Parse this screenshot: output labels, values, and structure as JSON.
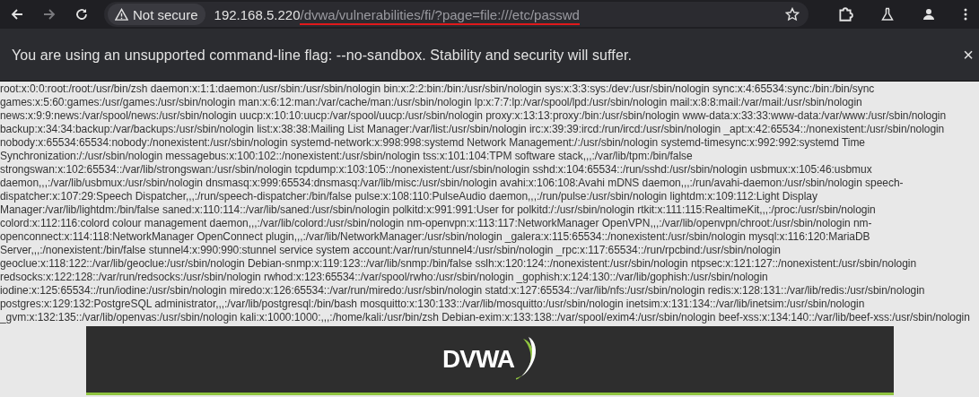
{
  "toolbar": {
    "security_label": "Not secure",
    "url_host": "192.168.5.220",
    "url_path": "/dvwa/vulnerabilities/fi/?page=file:///etc/passwd",
    "back_enabled": true,
    "forward_enabled": false
  },
  "infobar": {
    "message": "You are using an unsupported command-line flag: --no-sandbox. Stability and security will suffer.",
    "close": "×"
  },
  "page": {
    "file_lines": [
      "root:x:0:0:root:/root:/usr/bin/zsh daemon:x:1:1:daemon:/usr/sbin:/usr/sbin/nologin bin:x:2:2:bin:/bin:/usr/sbin/nologin sys:x:3:3:sys:/dev:/usr/sbin/nologin sync:x:4:65534:sync:/bin:/bin/sync",
      "games:x:5:60:games:/usr/games:/usr/sbin/nologin man:x:6:12:man:/var/cache/man:/usr/sbin/nologin lp:x:7:7:lp:/var/spool/lpd:/usr/sbin/nologin mail:x:8:8:mail:/var/mail:/usr/sbin/nologin",
      "news:x:9:9:news:/var/spool/news:/usr/sbin/nologin uucp:x:10:10:uucp:/var/spool/uucp:/usr/sbin/nologin proxy:x:13:13:proxy:/bin:/usr/sbin/nologin www-data:x:33:33:www-data:/var/www:/usr/sbin/nologin",
      "backup:x:34:34:backup:/var/backups:/usr/sbin/nologin list:x:38:38:Mailing List Manager:/var/list:/usr/sbin/nologin irc:x:39:39:ircd:/run/ircd:/usr/sbin/nologin _apt:x:42:65534::/nonexistent:/usr/sbin/nologin",
      "nobody:x:65534:65534:nobody:/nonexistent:/usr/sbin/nologin systemd-network:x:998:998:systemd Network Management:/:/usr/sbin/nologin systemd-timesync:x:992:992:systemd Time",
      "Synchronization:/:/usr/sbin/nologin messagebus:x:100:102::/nonexistent:/usr/sbin/nologin tss:x:101:104:TPM software stack,,,:/var/lib/tpm:/bin/false",
      "strongswan:x:102:65534::/var/lib/strongswan:/usr/sbin/nologin tcpdump:x:103:105::/nonexistent:/usr/sbin/nologin sshd:x:104:65534::/run/sshd:/usr/sbin/nologin usbmux:x:105:46:usbmux",
      "daemon,,,:/var/lib/usbmux:/usr/sbin/nologin dnsmasq:x:999:65534:dnsmasq:/var/lib/misc:/usr/sbin/nologin avahi:x:106:108:Avahi mDNS daemon,,,:/run/avahi-daemon:/usr/sbin/nologin speech-",
      "dispatcher:x:107:29:Speech Dispatcher,,,:/run/speech-dispatcher:/bin/false pulse:x:108:110:PulseAudio daemon,,,:/run/pulse:/usr/sbin/nologin lightdm:x:109:112:Light Display",
      "Manager:/var/lib/lightdm:/bin/false saned:x:110:114::/var/lib/saned:/usr/sbin/nologin polkitd:x:991:991:User for polkitd:/:/usr/sbin/nologin rtkit:x:111:115:RealtimeKit,,,:/proc:/usr/sbin/nologin",
      "colord:x:112:116:colord colour management daemon,,,:/var/lib/colord:/usr/sbin/nologin nm-openvpn:x:113:117:NetworkManager OpenVPN,,,:/var/lib/openvpn/chroot:/usr/sbin/nologin nm-",
      "openconnect:x:114:118:NetworkManager OpenConnect plugin,,,:/var/lib/NetworkManager:/usr/sbin/nologin _galera:x:115:65534::/nonexistent:/usr/sbin/nologin mysql:x:116:120:MariaDB",
      "Server,,,:/nonexistent:/bin/false stunnel4:x:990:990:stunnel service system account:/var/run/stunnel4:/usr/sbin/nologin _rpc:x:117:65534::/run/rpcbind:/usr/sbin/nologin",
      "geoclue:x:118:122::/var/lib/geoclue:/usr/sbin/nologin Debian-snmp:x:119:123::/var/lib/snmp:/bin/false sslh:x:120:124::/nonexistent:/usr/sbin/nologin ntpsec:x:121:127::/nonexistent:/usr/sbin/nologin",
      "redsocks:x:122:128::/var/run/redsocks:/usr/sbin/nologin rwhod:x:123:65534::/var/spool/rwho:/usr/sbin/nologin _gophish:x:124:130::/var/lib/gophish:/usr/sbin/nologin",
      "iodine:x:125:65534::/run/iodine:/usr/sbin/nologin miredo:x:126:65534::/var/run/miredo:/usr/sbin/nologin statd:x:127:65534::/var/lib/nfs:/usr/sbin/nologin redis:x:128:131::/var/lib/redis:/usr/sbin/nologin",
      "postgres:x:129:132:PostgreSQL administrator,,,:/var/lib/postgresql:/bin/bash mosquitto:x:130:133::/var/lib/mosquitto:/usr/sbin/nologin inetsim:x:131:134::/var/lib/inetsim:/usr/sbin/nologin",
      "_gvm:x:132:135::/var/lib/openvas:/usr/sbin/nologin kali:x:1000:1000:,,,:/home/kali:/usr/bin/zsh Debian-exim:x:133:138::/var/spool/exim4:/usr/sbin/nologin beef-xss:x:134:140::/var/lib/beef-xss:/usr/sbin/nologin"
    ],
    "logo_text": "DVWA"
  }
}
